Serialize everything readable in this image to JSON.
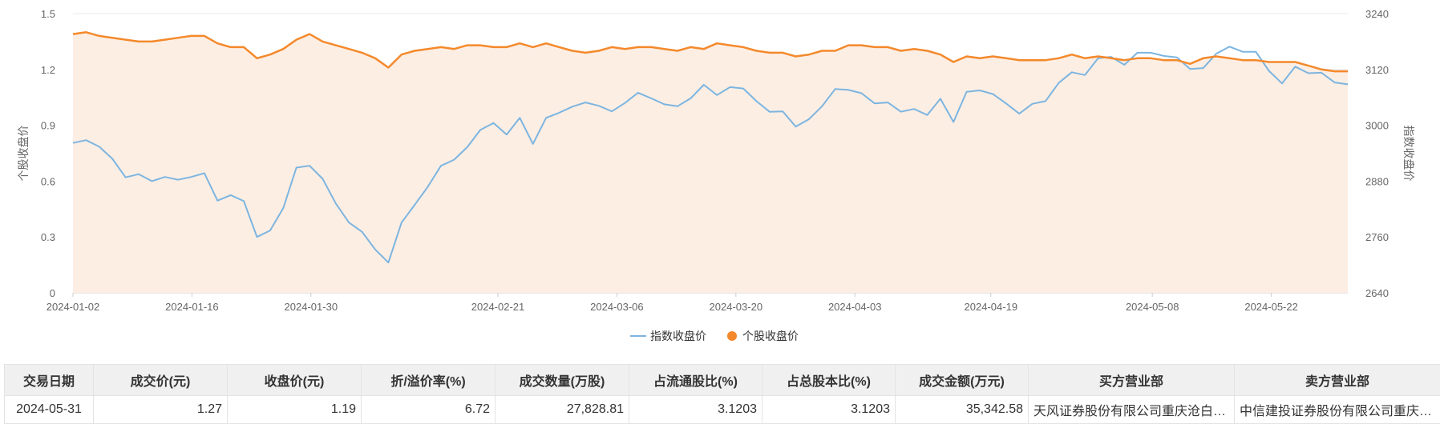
{
  "chart_data": {
    "type": "line",
    "x_ticks": [
      "2024-01-02",
      "2024-01-16",
      "2024-01-30",
      "2024-02-21",
      "2024-03-06",
      "2024-03-20",
      "2024-04-03",
      "2024-04-19",
      "2024-05-08",
      "2024-05-22"
    ],
    "x_range": [
      "2024-01-02",
      "2024-05-31"
    ],
    "left_axis": {
      "label": "个股收盘价",
      "ticks": [
        "0",
        "0.3",
        "0.6",
        "0.9",
        "1.2",
        "1.5"
      ],
      "ylim": [
        0,
        1.5
      ]
    },
    "right_axis": {
      "label": "指数收盘价",
      "ticks": [
        "2640",
        "2760",
        "2880",
        "3000",
        "3120",
        "3240"
      ],
      "ylim": [
        2640,
        3240
      ]
    },
    "legend_position": "bottom-center",
    "series": [
      {
        "name": "指数收盘价",
        "axis": "right",
        "color": "#7cb5e0",
        "fill": false,
        "values": [
          2962,
          2968,
          2954,
          2928,
          2888,
          2895,
          2880,
          2889,
          2883,
          2889,
          2897,
          2838,
          2850,
          2837,
          2760,
          2774,
          2822,
          2909,
          2913,
          2885,
          2832,
          2791,
          2771,
          2733,
          2705,
          2791,
          2829,
          2868,
          2913,
          2926,
          2953,
          2990,
          3005,
          2980,
          3016,
          2960,
          3016,
          3027,
          3040,
          3049,
          3042,
          3030,
          3048,
          3070,
          3058,
          3045,
          3041,
          3058,
          3087,
          3065,
          3082,
          3079,
          3052,
          3029,
          3030,
          2997,
          3013,
          3041,
          3078,
          3076,
          3069,
          3047,
          3049,
          3029,
          3035,
          3022,
          3057,
          3007,
          3072,
          3075,
          3067,
          3047,
          3025,
          3046,
          3052,
          3091,
          3114,
          3108,
          3144,
          3147,
          3130,
          3156,
          3156,
          3149,
          3146,
          3121,
          3123,
          3154,
          3169,
          3158,
          3158,
          3117,
          3090,
          3126,
          3112,
          3113,
          3092,
          3088
        ]
      },
      {
        "name": "个股收盘价",
        "axis": "left",
        "color": "#f4892b",
        "fill": true,
        "fill_color": "#fdeee4",
        "values": [
          1.39,
          1.4,
          1.38,
          1.37,
          1.36,
          1.35,
          1.35,
          1.36,
          1.37,
          1.38,
          1.38,
          1.34,
          1.32,
          1.32,
          1.26,
          1.28,
          1.31,
          1.36,
          1.39,
          1.35,
          1.33,
          1.31,
          1.29,
          1.26,
          1.21,
          1.28,
          1.3,
          1.31,
          1.32,
          1.31,
          1.33,
          1.33,
          1.32,
          1.32,
          1.34,
          1.32,
          1.34,
          1.32,
          1.3,
          1.29,
          1.3,
          1.32,
          1.31,
          1.32,
          1.32,
          1.31,
          1.3,
          1.32,
          1.31,
          1.34,
          1.33,
          1.32,
          1.3,
          1.29,
          1.29,
          1.27,
          1.28,
          1.3,
          1.3,
          1.33,
          1.33,
          1.32,
          1.32,
          1.3,
          1.31,
          1.3,
          1.28,
          1.24,
          1.27,
          1.26,
          1.27,
          1.26,
          1.25,
          1.25,
          1.25,
          1.26,
          1.28,
          1.26,
          1.27,
          1.26,
          1.25,
          1.26,
          1.26,
          1.25,
          1.25,
          1.23,
          1.26,
          1.27,
          1.26,
          1.25,
          1.25,
          1.24,
          1.24,
          1.24,
          1.22,
          1.2,
          1.19,
          1.19
        ]
      }
    ]
  },
  "table": {
    "headers": [
      "交易日期",
      "成交价(元)",
      "收盘价(元)",
      "折/溢价率(%)",
      "成交数量(万股)",
      "占流通股比(%)",
      "占总股本比(%)",
      "成交金额(万元)",
      "买方营业部",
      "卖方营业部"
    ],
    "rows": [
      [
        "2024-05-31",
        "1.27",
        "1.19",
        "6.72",
        "27,828.81",
        "3.1203",
        "3.1203",
        "35,342.58",
        "天风证券股份有限公司重庆沧白…",
        "中信建投证券股份有限公司重庆…"
      ]
    ]
  }
}
